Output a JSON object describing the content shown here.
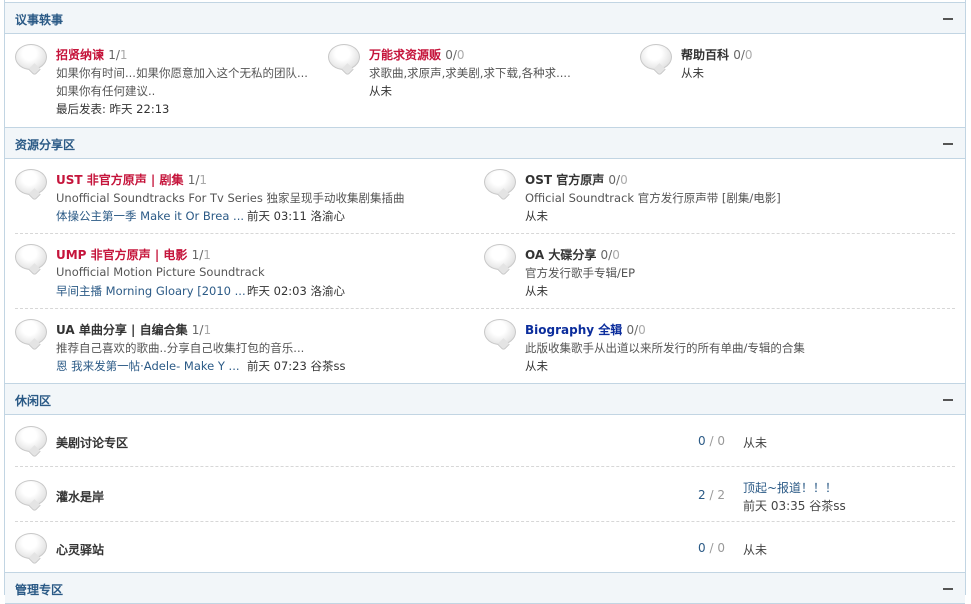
{
  "categories": {
    "c1": {
      "title": "议事轶事"
    },
    "c2": {
      "title": "资源分享区"
    },
    "c3": {
      "title": "休闲区"
    },
    "c4": {
      "title": "管理专区"
    }
  },
  "c1": {
    "f1": {
      "name": "招贤纳谏",
      "count": "1/",
      "count_b": "1",
      "desc1": "如果你有时间...如果你愿意加入这个无私的团队...",
      "desc2": "如果你有任何建议..",
      "last": "最后发表: 昨天 22:13"
    },
    "f2": {
      "name": "万能求资源贩",
      "count": "0/",
      "count_b": "0",
      "desc1": "求歌曲,求原声,求美剧,求下载,各种求....",
      "last": "从未"
    },
    "f3": {
      "name": "帮助百科",
      "count": "0/",
      "count_b": "0",
      "last": "从未"
    }
  },
  "c2": {
    "f1": {
      "name": "UST 非官方原声 | 剧集",
      "count": "1/",
      "count_b": "1",
      "desc": "Unofficial Soundtracks For Tv Series 独家呈现手动收集剧集插曲",
      "last_title": "体操公主第一季 Make it Or Brea ...",
      "last_time": "前天 03:11 洛渝心"
    },
    "f2": {
      "name": "OST 官方原声",
      "count": "0/",
      "count_b": "0",
      "desc": "Official Soundtrack 官方发行原声带 [剧集/电影]",
      "last": "从未"
    },
    "f3": {
      "name": "UMP 非官方原声 | 电影",
      "count": "1/",
      "count_b": "1",
      "desc": "Unofficial Motion Picture Soundtrack",
      "last_title": "早间主播 Morning Gloary [2010 ...",
      "last_time": "昨天 02:03 洛渝心"
    },
    "f4": {
      "name": "OA 大碟分享",
      "count": "0/",
      "count_b": "0",
      "desc": "官方发行歌手专辑/EP",
      "last": "从未"
    },
    "f5": {
      "name": "UA 单曲分享 | 自编合集",
      "count": "1/",
      "count_b": "1",
      "desc": "推荐自己喜欢的歌曲..分享自己收集打包的音乐...",
      "last_title": "恩 我来发第一帖·Adele- Make Y ...",
      "last_time": "前天 07:23 谷茶ss"
    },
    "f6": {
      "name": "Biography 全辑",
      "count": "0/",
      "count_b": "0",
      "desc": "此版收集歌手从出道以来所发行的所有单曲/专辑的合集",
      "last": "从未"
    }
  },
  "c3": {
    "f1": {
      "name": "美剧讨论专区",
      "threads": "0",
      "sep": " / ",
      "posts": "0",
      "last": "从未"
    },
    "f2": {
      "name": "灌水是岸",
      "threads": "2",
      "sep": " / ",
      "posts": "2",
      "last_title": "顶起~报道！！！",
      "last_time": "前天 03:35 谷茶ss"
    },
    "f3": {
      "name": "心灵驿站",
      "threads": "0",
      "sep": " / ",
      "posts": "0",
      "last": "从未"
    }
  }
}
